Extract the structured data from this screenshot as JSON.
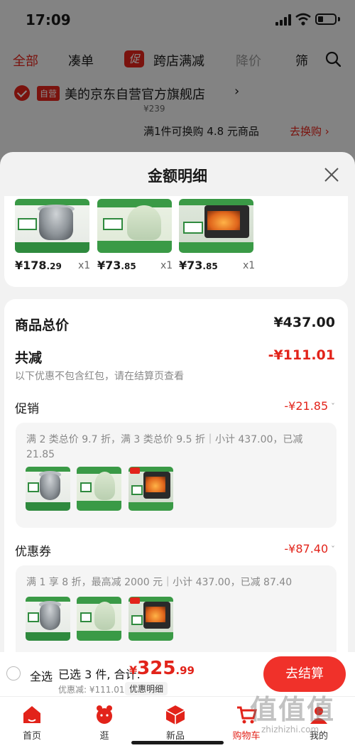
{
  "status": {
    "time": "17:09"
  },
  "filters": {
    "all": "全部",
    "combine": "凑单",
    "promo_badge": "促",
    "cross_store": "跨店满减",
    "price_drop": "降价",
    "sift": "筛"
  },
  "shop": {
    "badge": "自营",
    "name": "美的京东自营官方旗舰店",
    "chevron": "›",
    "old_price": "¥239",
    "swap_text": "满1件可换购 4.8 元商品",
    "swap_link": "去换购 ›"
  },
  "sheet": {
    "title": "金额明细"
  },
  "products": [
    {
      "price_int": "¥178",
      "price_dec": ".29",
      "qty": "x1"
    },
    {
      "price_int": "¥73",
      "price_dec": ".85",
      "qty": "x1"
    },
    {
      "price_int": "¥73",
      "price_dec": ".85",
      "qty": "x1"
    }
  ],
  "summary": {
    "total_label": "商品总价",
    "total_value": "¥437.00",
    "reduce_label": "共减",
    "reduce_value": "-¥111.01",
    "note": "以下优惠不包含红包，请在结算页查看"
  },
  "promotion": {
    "label": "促销",
    "value": "-¥21.85",
    "desc": "满 2 类总价 9.7 折，满 3 类总价 9.5 折｜小计 437.00，已减 21.85"
  },
  "coupon": {
    "label": "优惠券",
    "value": "-¥87.40",
    "desc": "满 1 享 8 折，最高减 2000 元｜小计 437.00，已减 87.40"
  },
  "checkout": {
    "select_all": "全选",
    "selected": "已选 3 件, 合计:",
    "currency": "¥",
    "total_int": "325",
    "total_dec": ".99",
    "discount": "优惠减: ¥111.01",
    "detail_chip": "优惠明细",
    "pay_button": "去结算"
  },
  "tabs": [
    {
      "label": "首页",
      "icon": "home-icon"
    },
    {
      "label": "逛",
      "icon": "explore-icon"
    },
    {
      "label": "新品",
      "icon": "new-icon"
    },
    {
      "label": "购物车",
      "icon": "cart-icon"
    },
    {
      "label": "我的",
      "icon": "profile-icon"
    }
  ],
  "watermark": {
    "mark": "值值值",
    "url": "zhizhizhi.com"
  },
  "colors": {
    "accent": "#e2231a",
    "pay_button": "#f0312a",
    "promo_green": "#3a9a46"
  }
}
